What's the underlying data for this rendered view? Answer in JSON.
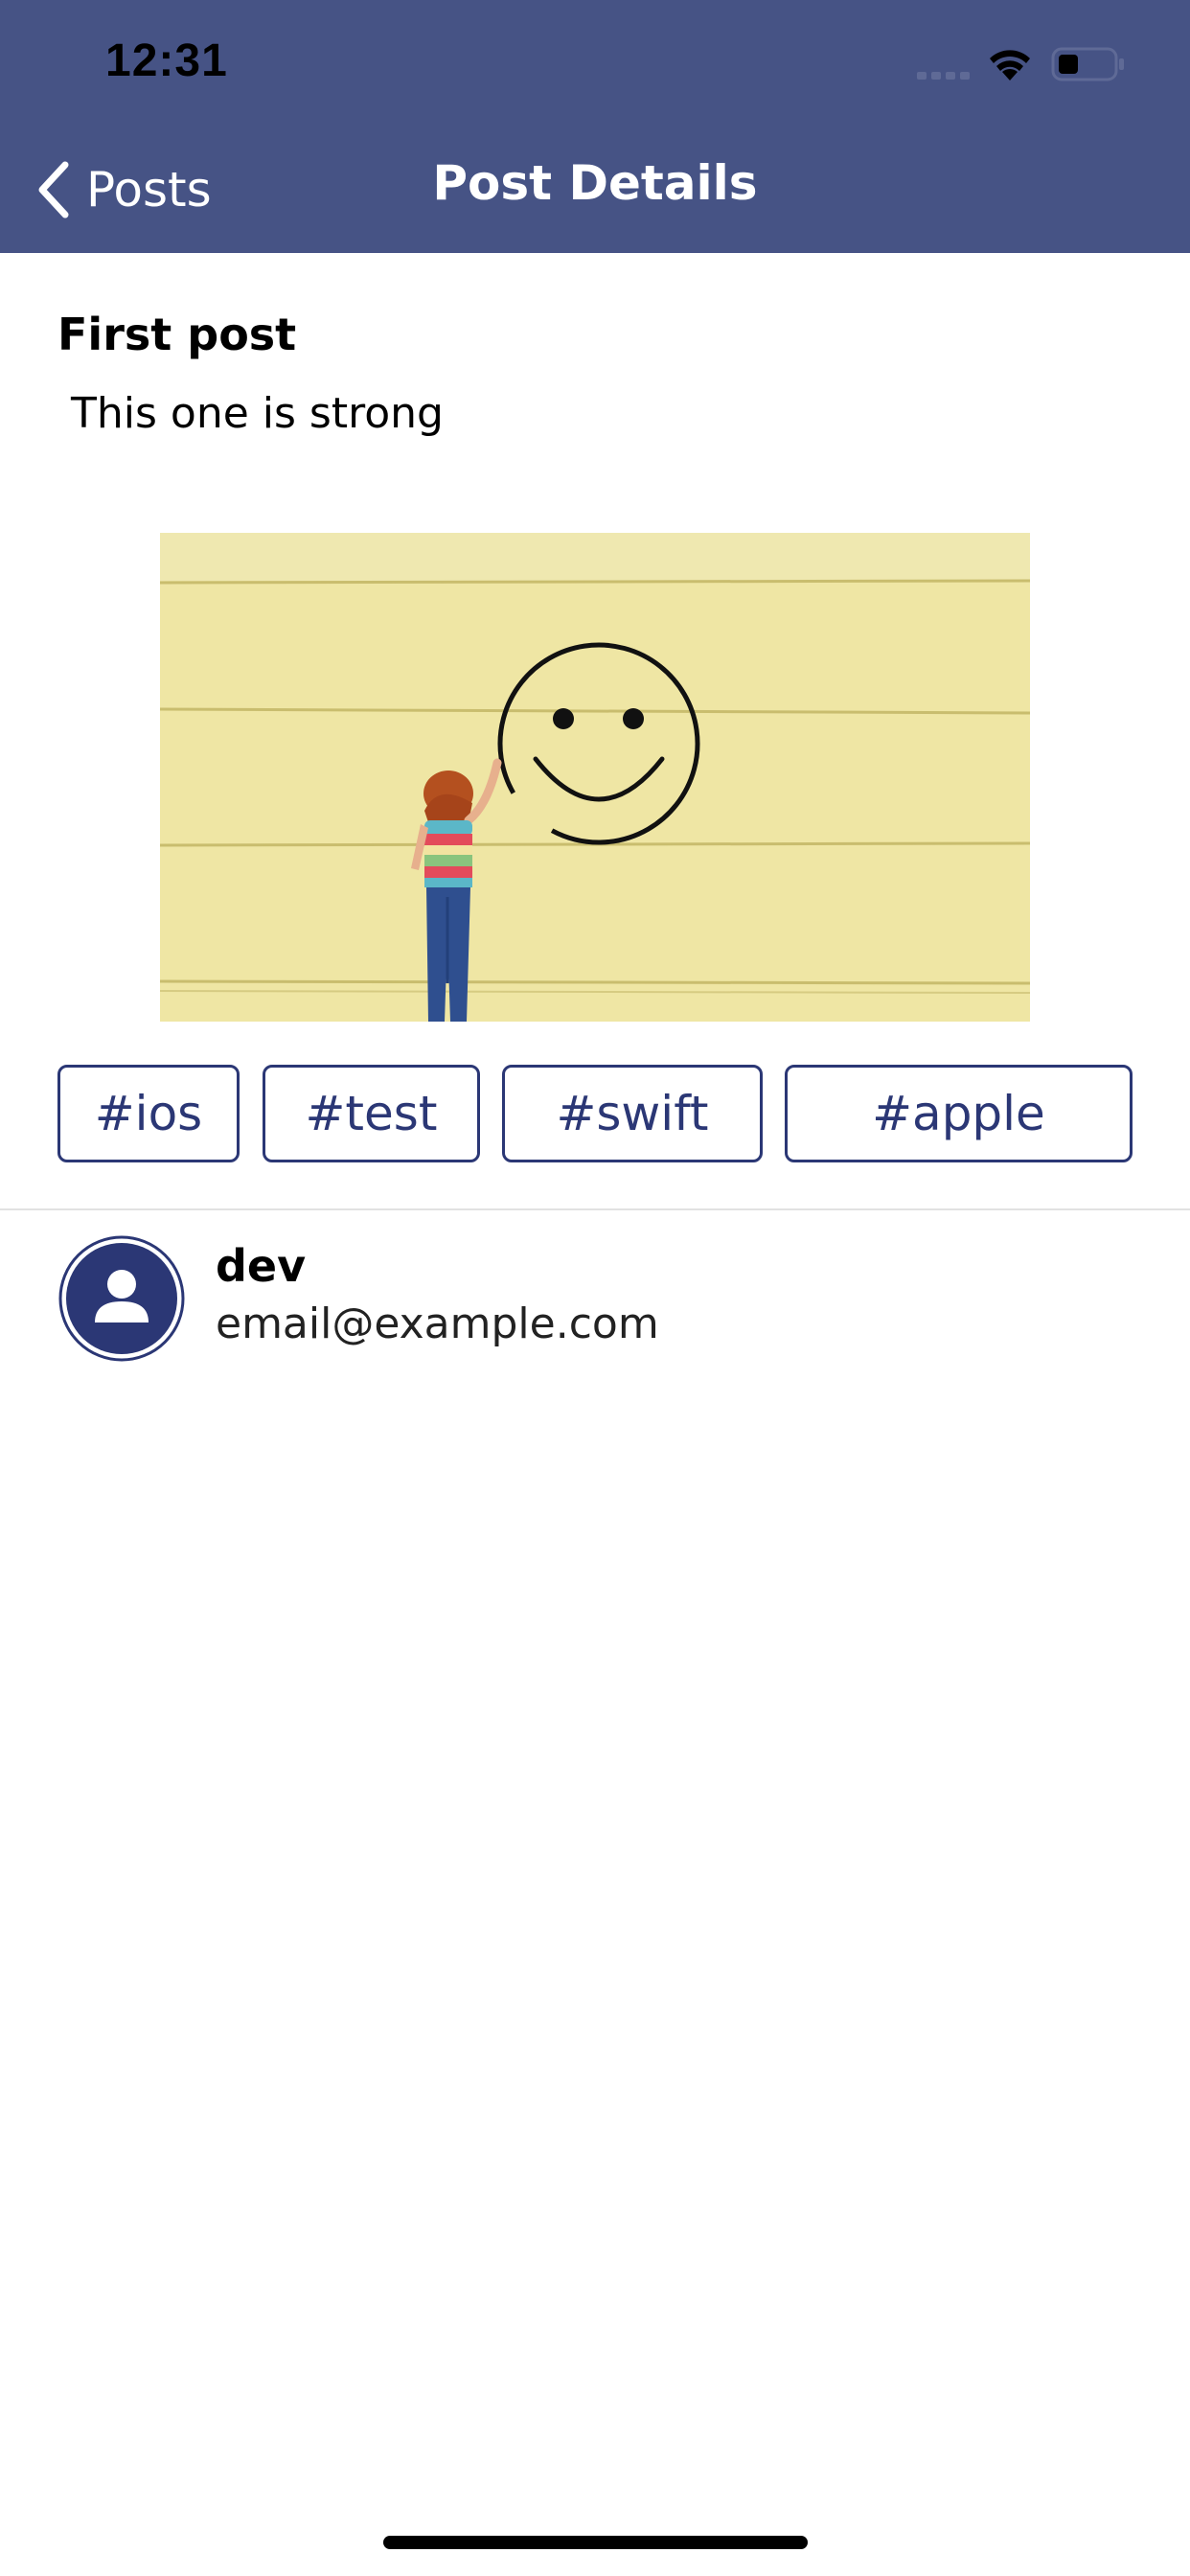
{
  "status_bar": {
    "time": "12:31",
    "icons": [
      "cellular-signal-icon",
      "wifi-icon",
      "battery-icon"
    ]
  },
  "nav": {
    "back_label": "Posts",
    "title": "Post Details",
    "background_color": "#465385"
  },
  "post": {
    "title": "First post",
    "body": "This one is strong",
    "image": "photo of child drawing a smiley face on a yellow wall"
  },
  "tags": [
    {
      "label": "#ios"
    },
    {
      "label": "#test"
    },
    {
      "label": "#swift"
    },
    {
      "label": "#apple"
    }
  ],
  "author": {
    "name": "dev",
    "email": "email@example.com",
    "avatar_icon": "user-avatar-icon"
  },
  "colors": {
    "accent": "#2b3775",
    "header": "#465385",
    "image_background": "#efe6a4"
  }
}
